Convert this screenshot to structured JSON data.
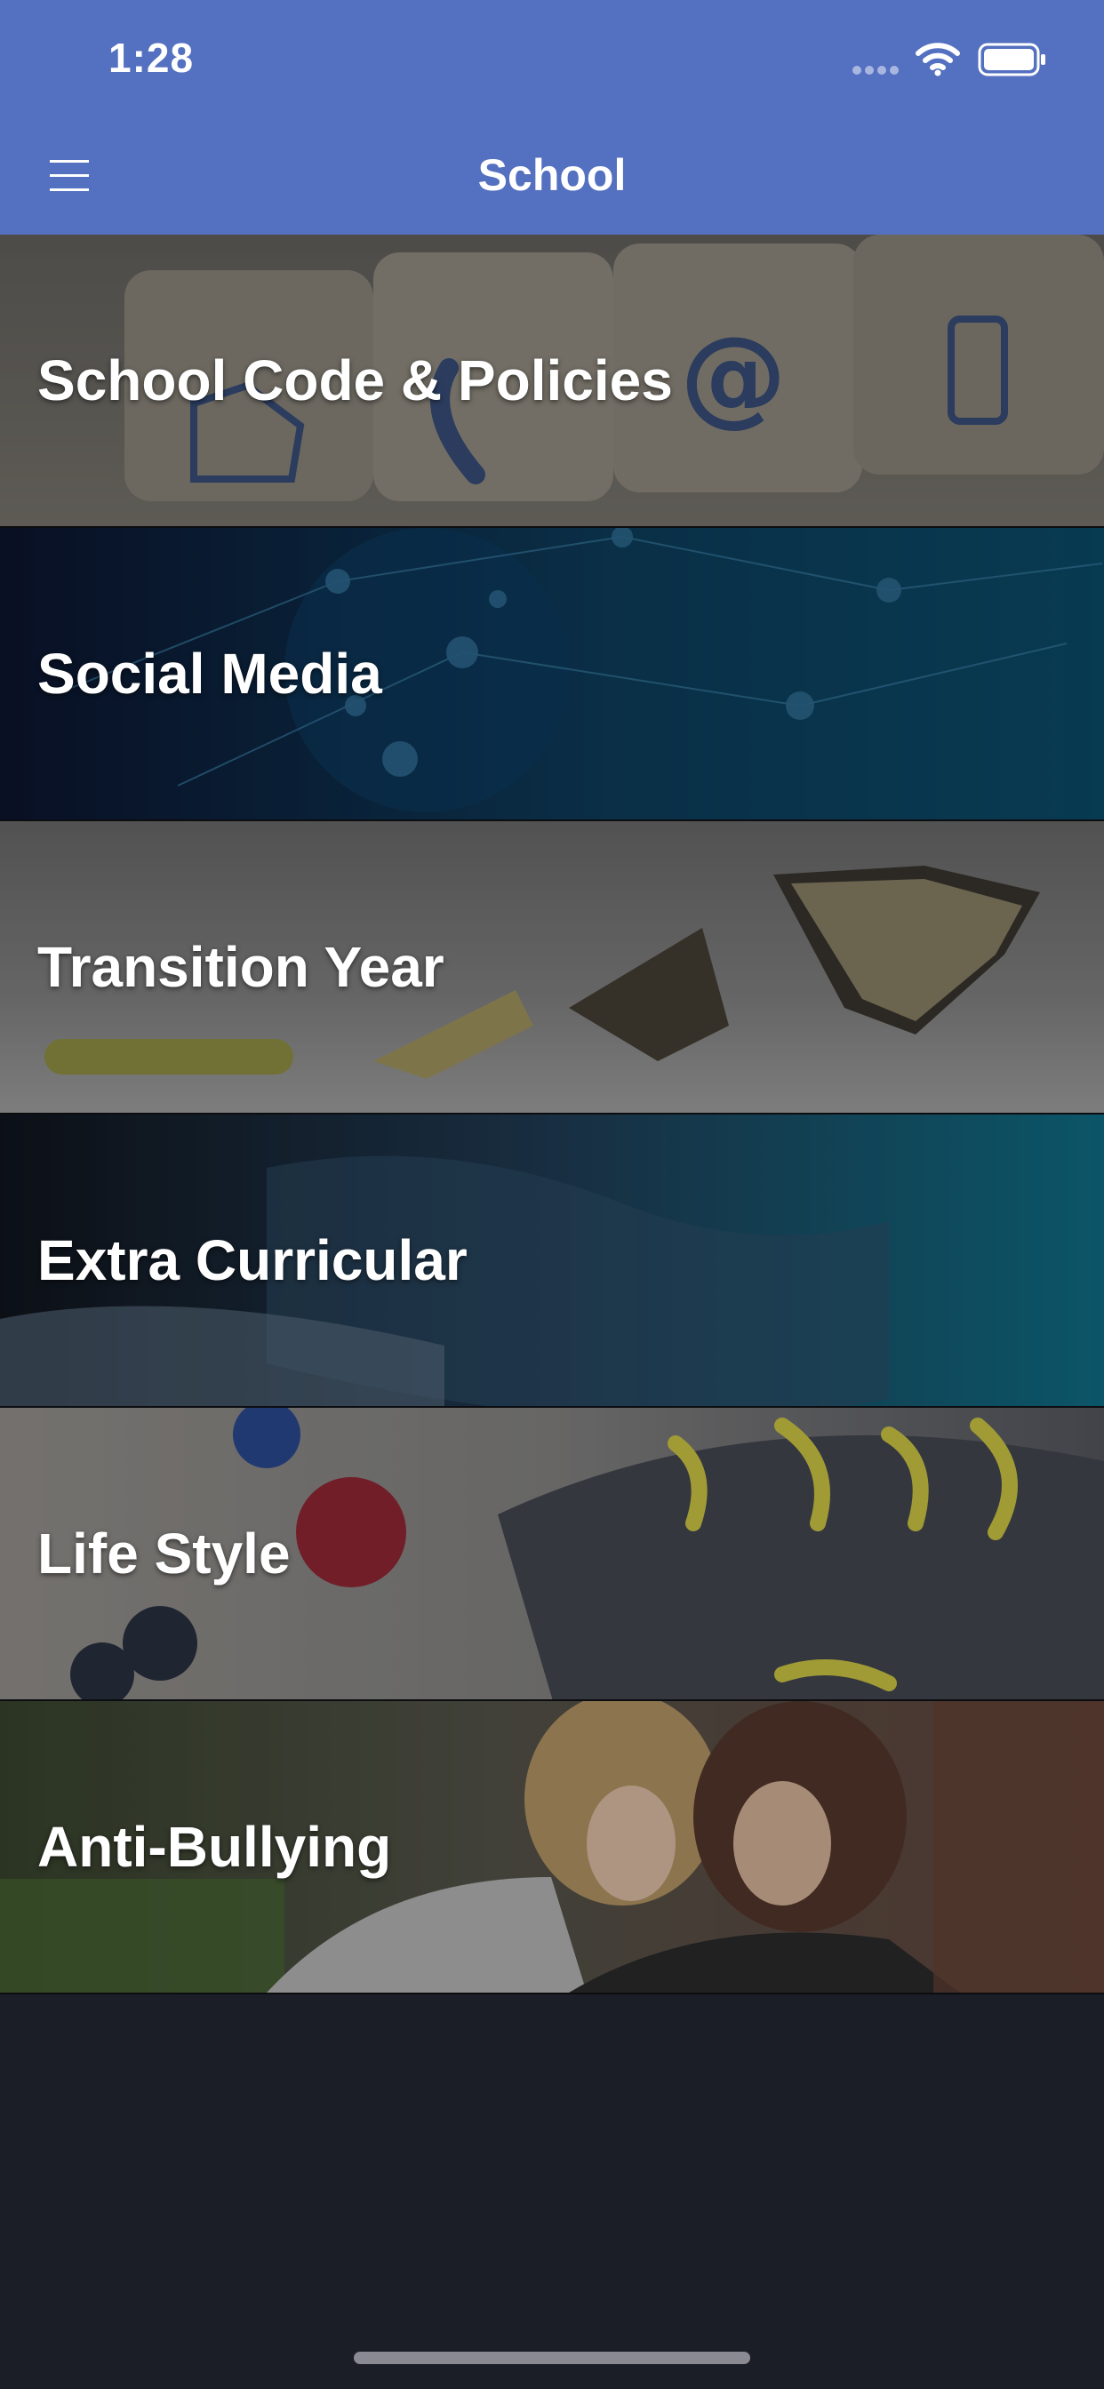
{
  "status_bar": {
    "time": "1:28"
  },
  "nav": {
    "title": "School"
  },
  "rows": [
    {
      "label": "School Code & Policies"
    },
    {
      "label": "Social Media"
    },
    {
      "label": "Transition Year"
    },
    {
      "label": "Extra Curricular"
    },
    {
      "label": "Life Style"
    },
    {
      "label": "Anti-Bullying"
    }
  ],
  "colors": {
    "header": "#5470c0",
    "background": "#1b1d27",
    "text": "#ffffff"
  },
  "icons": [
    "menu-icon",
    "wifi-icon",
    "battery-icon",
    "signal-icon"
  ]
}
